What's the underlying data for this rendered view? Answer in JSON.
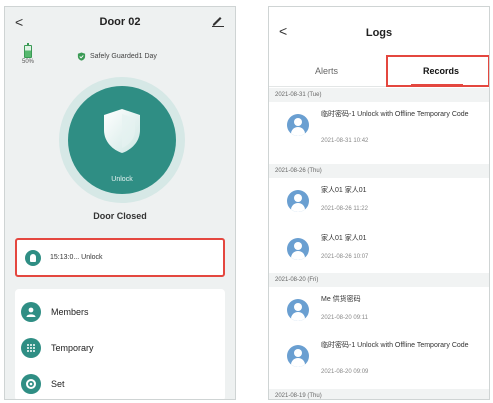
{
  "left": {
    "header": {
      "back_glyph": "<",
      "title": "Door 02",
      "edit_icon": "pencil-icon"
    },
    "battery": {
      "percent": "50%",
      "level": 0.5,
      "icon": "battery-icon"
    },
    "guard_status": {
      "text": "Safely Guarded1 Day",
      "icon": "shield-check-icon"
    },
    "unlock": {
      "label": "Unlock",
      "icon": "shield-icon",
      "accent": "#2f8e84"
    },
    "door_status": "Door Closed",
    "latest_log": {
      "text": "15:13:0... Unlock",
      "icon": "lock-icon"
    },
    "menu": [
      {
        "label": "Members",
        "icon": "members-icon"
      },
      {
        "label": "Temporary",
        "icon": "keypad-icon"
      },
      {
        "label": "Set",
        "icon": "settings-icon"
      }
    ]
  },
  "right": {
    "header": {
      "back_glyph": "<",
      "title": "Logs"
    },
    "tabs": [
      {
        "label": "Alerts",
        "active": false
      },
      {
        "label": "Records",
        "active": true
      }
    ],
    "highlight_color": "#e4473f",
    "groups": [
      {
        "date": "2021-08-31 (Tue)",
        "records": [
          {
            "title": "临时密码-1 Unlock with Offline Temporary Code",
            "time": "2021-08-31 10:42"
          }
        ]
      },
      {
        "date": "2021-08-26 (Thu)",
        "records": [
          {
            "title": "家人01 家人01",
            "time": "2021-08-26 11:22"
          },
          {
            "title": "家人01 家人01",
            "time": "2021-08-26 10:07"
          }
        ]
      },
      {
        "date": "2021-08-20 (Fri)",
        "records": [
          {
            "title": "Me 供货密码",
            "time": "2021-08-20 09:11"
          },
          {
            "title": "临时密码-1 Unlock with Offline Temporary Code",
            "time": "2021-08-20 09:09"
          }
        ]
      },
      {
        "date": "2021-08-19 (Thu)",
        "records": []
      }
    ]
  }
}
